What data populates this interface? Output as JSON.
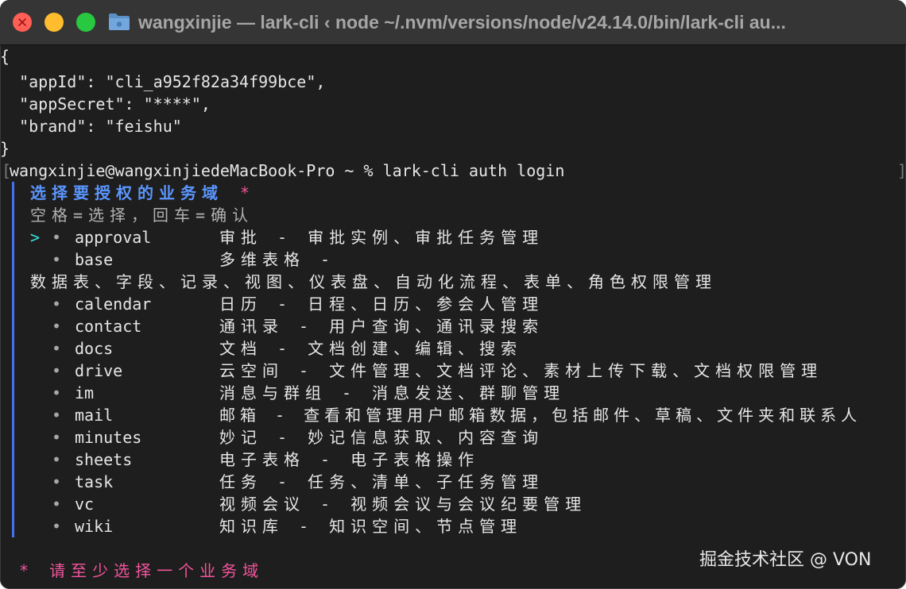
{
  "window": {
    "title": "wangxinjie — lark-cli ‹ node ~/.nvm/versions/node/v24.14.0/bin/lark-cli au...",
    "traffic_lights": [
      "close",
      "minimize",
      "zoom"
    ],
    "folder_icon": "folder-icon"
  },
  "terminal": {
    "json_output": {
      "open": "{",
      "app_id_line": "  \"appId\": \"cli_a952f82a34f99bce\",",
      "app_secret_line": "  \"appSecret\": \"****\",",
      "brand_line": "  \"brand\": \"feishu\"",
      "close": "}"
    },
    "prompt": {
      "open_bracket": "[",
      "text": "wangxinjie@wangxinjiedeMacBook-Pro ~ % lark-cli auth login",
      "close_bracket": "]"
    },
    "form": {
      "question": "选择要授权的业务域",
      "required_mark": "*",
      "hint": "空格=选择，回车=确认",
      "cursor": ">",
      "bullet": "•",
      "options": [
        {
          "name": "approval",
          "desc": "审批 - 审批实例、审批任务管理"
        },
        {
          "name": "base",
          "desc": "多维表格 -",
          "desc_wrap": "数据表、字段、记录、视图、仪表盘、自动化流程、表单、角色权限管理"
        },
        {
          "name": "calendar",
          "desc": "日历 - 日程、日历、参会人管理"
        },
        {
          "name": "contact",
          "desc": "通讯录 - 用户查询、通讯录搜索"
        },
        {
          "name": "docs",
          "desc": "文档 - 文档创建、编辑、搜索"
        },
        {
          "name": "drive",
          "desc": "云空间 - 文件管理、文档评论、素材上传下载、文档权限管理"
        },
        {
          "name": "im",
          "desc": "消息与群组 - 消息发送、群聊管理"
        },
        {
          "name": "mail",
          "desc": "邮箱 - 查看和管理用户邮箱数据，包括邮件、草稿、文件夹和联系人"
        },
        {
          "name": "minutes",
          "desc": "妙记 - 妙记信息获取、内容查询"
        },
        {
          "name": "sheets",
          "desc": "电子表格 - 电子表格操作"
        },
        {
          "name": "task",
          "desc": "任务 - 任务、清单、子任务管理"
        },
        {
          "name": "vc",
          "desc": "视频会议 - 视频会议与会议纪要管理"
        },
        {
          "name": "wiki",
          "desc": "知识库 - 知识空间、节点管理"
        }
      ],
      "error": "* 请至少选择一个业务域"
    },
    "watermark": "掘金技术社区 @ VON"
  },
  "colors": {
    "terminal_bg": "#1e1e1e",
    "titlebar_bg": "#353535",
    "text": "#e6e6e6",
    "accent_blue": "#5b96ff",
    "required_pink": "#f2549c",
    "cursor_cyan": "#35e1d6",
    "form_bar": "#4671ea"
  }
}
